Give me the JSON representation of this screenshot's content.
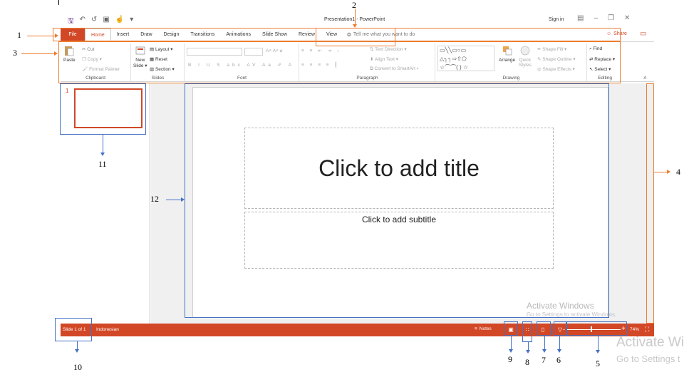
{
  "window": {
    "title": "Presentation1 - PowerPoint",
    "sign_in": "Sign in"
  },
  "tabs": [
    {
      "label": "File"
    },
    {
      "label": "Home"
    },
    {
      "label": "Insert"
    },
    {
      "label": "Draw"
    },
    {
      "label": "Design"
    },
    {
      "label": "Transitions"
    },
    {
      "label": "Animations"
    },
    {
      "label": "Slide Show"
    },
    {
      "label": "Review"
    },
    {
      "label": "View"
    }
  ],
  "tell_me": "Tell me what you want to do",
  "share": "Share",
  "ribbon": {
    "clipboard": {
      "label": "Clipboard",
      "paste": "Paste",
      "cut": "Cut",
      "copy": "Copy",
      "format_painter": "Format Painter"
    },
    "slides": {
      "label": "Slides",
      "new_slide": "New",
      "new_slide_2": "Slide",
      "layout": "Layout",
      "reset": "Reset",
      "section": "Section"
    },
    "font": {
      "label": "Font"
    },
    "paragraph": {
      "label": "Paragraph",
      "text_direction": "Text Direction",
      "align_text": "Align Text",
      "convert_smartart": "Convert to SmartArt"
    },
    "drawing": {
      "label": "Drawing",
      "arrange": "Arrange",
      "quick_styles_1": "Quick",
      "quick_styles_2": "Styles",
      "shape_fill": "Shape Fill",
      "shape_outline": "Shape Outline",
      "shape_effects": "Shape Effects"
    },
    "editing": {
      "label": "Editing",
      "find": "Find",
      "replace": "Replace",
      "select": "Select"
    }
  },
  "thumbnail": {
    "number": "1"
  },
  "slide": {
    "title_placeholder": "Click to add title",
    "subtitle_placeholder": "Click to add subtitle"
  },
  "status": {
    "slide_of": "Slide 1 of 1",
    "language": "Indonesian",
    "notes": "Notes",
    "zoom": "74%"
  },
  "watermark": {
    "line1": "Activate Windows",
    "line2": "Go to Settings to activate Windows.",
    "line3": "Activate Wi",
    "line4": "Go to Settings t"
  },
  "annotations": [
    "1",
    "2",
    "3",
    "4",
    "5",
    "6",
    "7",
    "8",
    "9",
    "10",
    "11",
    "12"
  ],
  "colors": {
    "accent": "#d24726",
    "annotation_orange": "#ed7d31",
    "annotation_blue": "#4472c4"
  }
}
